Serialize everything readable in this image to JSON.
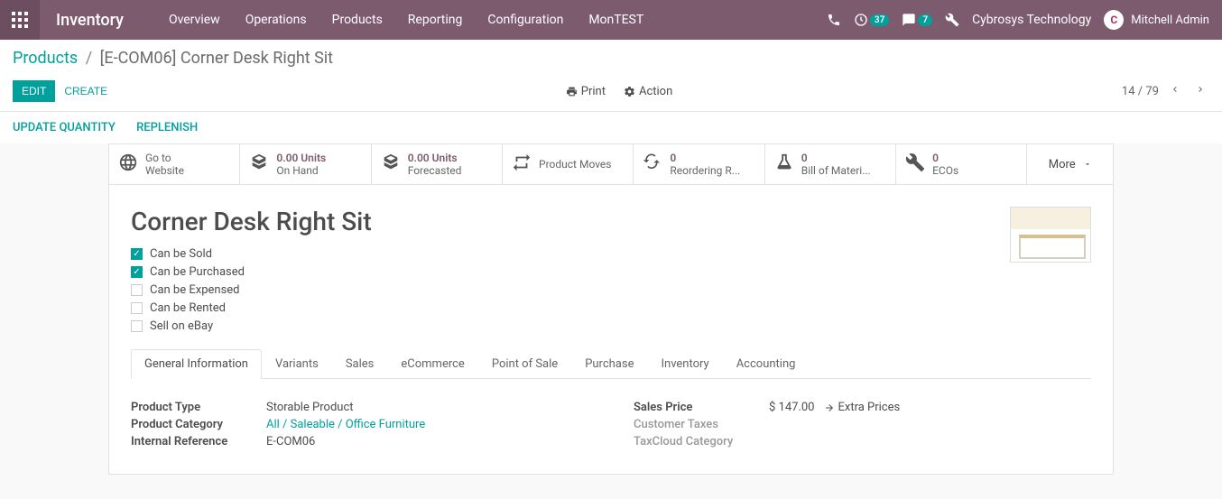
{
  "app_name": "Inventory",
  "nav": {
    "items": [
      "Overview",
      "Operations",
      "Products",
      "Reporting",
      "Configuration",
      "MonTEST"
    ],
    "notif_badge": "37",
    "msg_badge": "7",
    "company": "Cybrosys Technology",
    "user": "Mitchell Admin"
  },
  "breadcrumb": {
    "root": "Products",
    "current": "[E-COM06] Corner Desk Right Sit"
  },
  "buttons": {
    "edit": "Edit",
    "create": "Create",
    "print": "Print",
    "action": "Action",
    "update_qty": "Update Quantity",
    "replenish": "Replenish"
  },
  "pager": {
    "pos": "14",
    "total": "79"
  },
  "stats": [
    {
      "val": "",
      "lbl": "Go to",
      "lbl2": "Website"
    },
    {
      "val": "0.00 Units",
      "lbl": "On Hand"
    },
    {
      "val": "0.00 Units",
      "lbl": "Forecasted"
    },
    {
      "val": "",
      "lbl": "Product Moves"
    },
    {
      "val": "0",
      "lbl": "Reordering R..."
    },
    {
      "val": "0",
      "lbl": "Bill of Materi..."
    },
    {
      "val": "0",
      "lbl": "ECOs"
    }
  ],
  "more": "More",
  "product": {
    "title": "Corner Desk Right Sit",
    "checks": [
      {
        "label": "Can be Sold",
        "checked": true
      },
      {
        "label": "Can be Purchased",
        "checked": true
      },
      {
        "label": "Can be Expensed",
        "checked": false
      },
      {
        "label": "Can be Rented",
        "checked": false
      },
      {
        "label": "Sell on eBay",
        "checked": false
      }
    ]
  },
  "tabs": [
    "General Information",
    "Variants",
    "Sales",
    "eCommerce",
    "Point of Sale",
    "Purchase",
    "Inventory",
    "Accounting"
  ],
  "fields": {
    "left": [
      {
        "label": "Product Type",
        "value": "Storable Product"
      },
      {
        "label": "Product Category",
        "value": "All / Saleable / Office Furniture",
        "link": true
      },
      {
        "label": "Internal Reference",
        "value": "E-COM06"
      }
    ],
    "right": {
      "sales_price_label": "Sales Price",
      "sales_price": "$ 147.00",
      "extra_prices": "Extra Prices",
      "customer_taxes": "Customer Taxes",
      "taxcloud": "TaxCloud Category"
    }
  }
}
